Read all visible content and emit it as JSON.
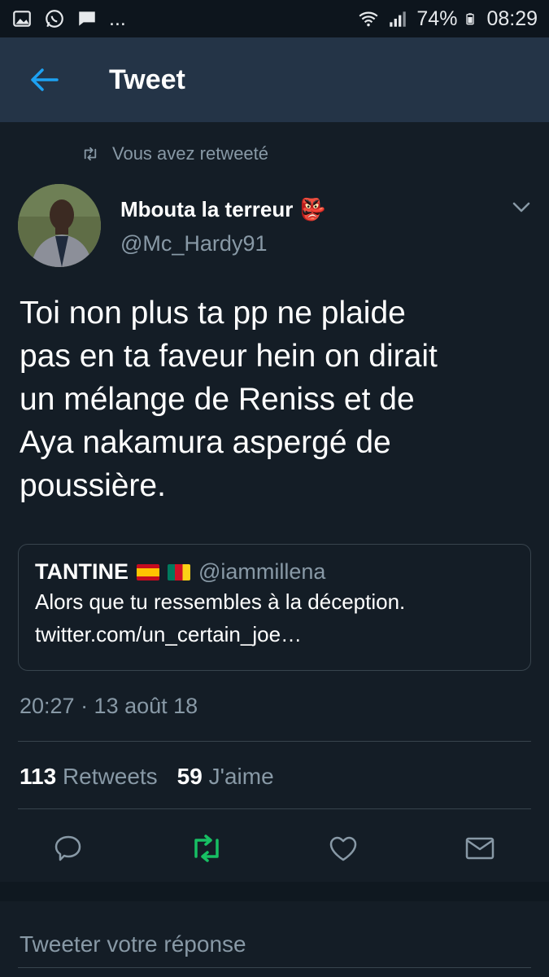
{
  "status_bar": {
    "battery": "74%",
    "time": "08:29",
    "more": "..."
  },
  "header": {
    "title": "Tweet",
    "back_icon": "arrow-left-icon"
  },
  "tweet": {
    "retweet_indicator": "Vous avez retweeté",
    "author_name": "Mbouta la terreur",
    "author_emoji": "👺",
    "author_handle": "@Mc_Hardy91",
    "text_lines": [
      "Toi non plus ta pp ne plaide",
      "pas en ta faveur hein on dirait",
      "un mélange de Reniss et de",
      "Aya nakamura aspergé de",
      "poussière."
    ],
    "quote": {
      "name": "TANTINE",
      "handle": "@iammillena",
      "text": "Alors que tu ressembles à la déception.",
      "link": "twitter.com/un_certain_joe…"
    },
    "timestamp": "20:27 · 13 août 18",
    "retweets_count": "113",
    "retweets_label": "Retweets",
    "likes_count": "59",
    "likes_label": "J'aime"
  },
  "reply": {
    "placeholder": "Tweeter votre réponse"
  },
  "colors": {
    "background": "#141d26",
    "header": "#243447",
    "accent_blue": "#1da1f2",
    "retweet_green": "#17bf63",
    "muted": "#8899a6"
  }
}
